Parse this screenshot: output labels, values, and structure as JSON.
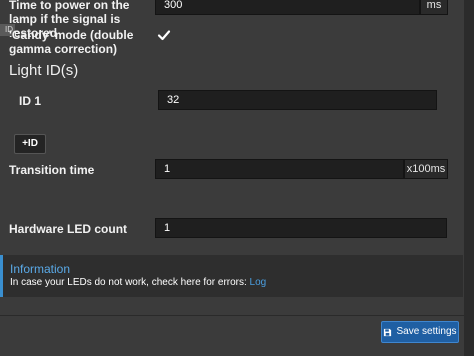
{
  "settings": {
    "power_delay": {
      "label": "Time to power on the lamp if the signal is restored",
      "value": "300",
      "unit": "ms"
    },
    "candy_mode": {
      "label": "'Candy' mode (double gamma correction)",
      "checked": true
    },
    "partial_tab_text": "ID",
    "light_ids": {
      "heading": "Light ID(s)",
      "items": [
        {
          "label": "ID 1",
          "value": "32"
        }
      ],
      "add_button": "ID",
      "add_icon": "plus-icon"
    },
    "transition_time": {
      "label": "Transition time",
      "value": "1",
      "unit": "x100ms"
    },
    "led_count": {
      "label": "Hardware LED count",
      "value": "1"
    }
  },
  "info": {
    "title": "Information",
    "text": "In case your LEDs do not work, check here for errors: ",
    "link": "Log"
  },
  "footer": {
    "save_label": "Save settings",
    "save_icon": "save-icon"
  },
  "colors": {
    "accent": "#1f5fa3",
    "info_border": "#3a8fd0",
    "background": "#3b3b3b"
  }
}
